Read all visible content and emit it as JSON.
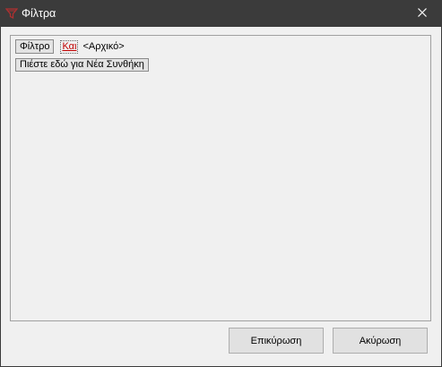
{
  "window": {
    "title": "Φίλτρα",
    "icon": "filter-app-icon"
  },
  "filter": {
    "field_button": "Φίλτρο",
    "operator_link": "Και",
    "root_label": "<Αρχικό>",
    "new_condition_button": "Πιέστε εδώ για Νέα Συνθήκη"
  },
  "footer": {
    "ok_label": "Επικύρωση",
    "cancel_label": "Ακύρωση"
  },
  "colors": {
    "titlebar": "#3b3b3b",
    "link": "#c00000"
  }
}
